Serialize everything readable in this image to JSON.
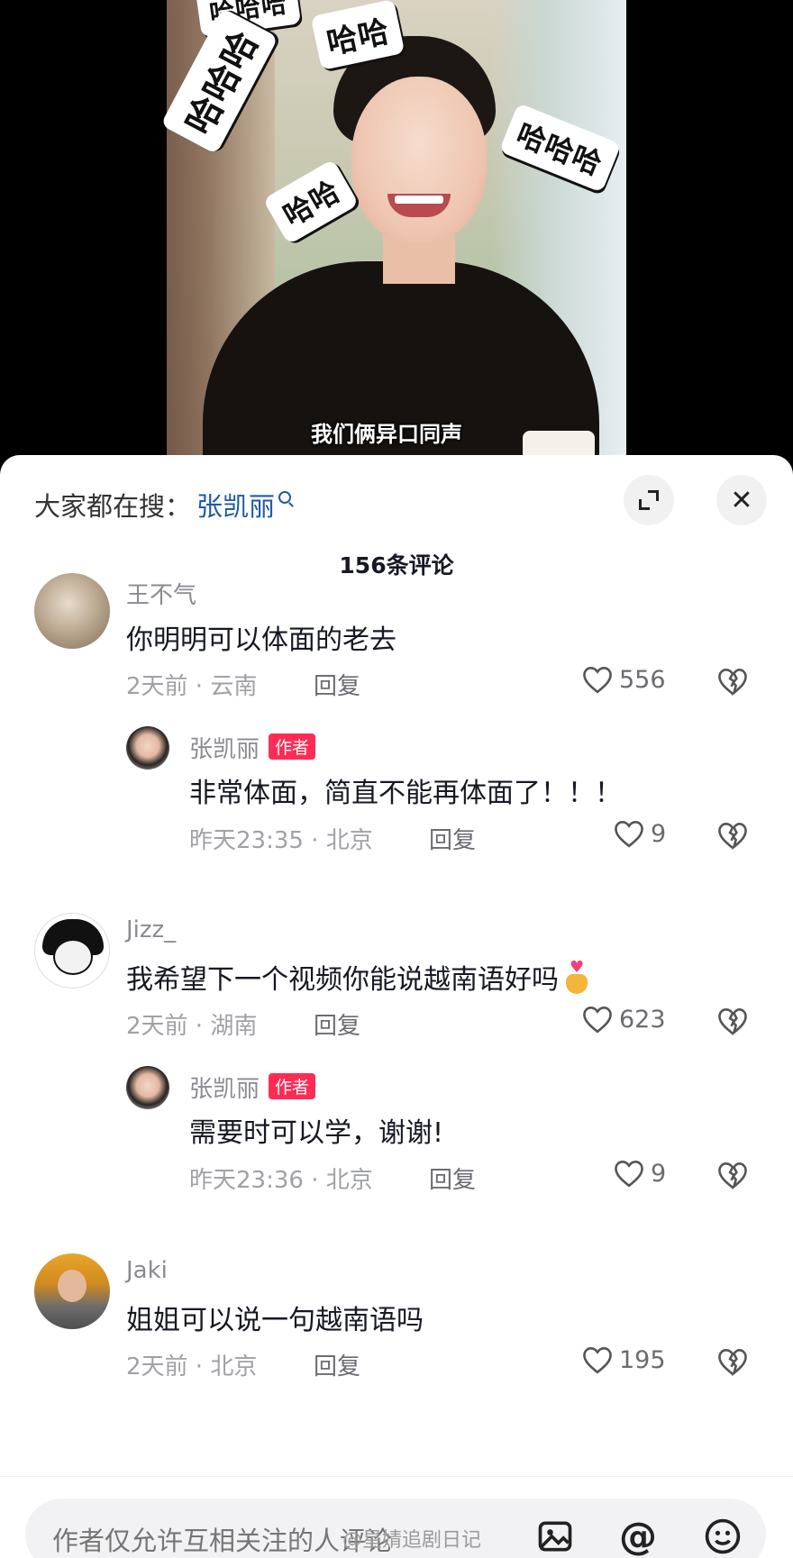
{
  "video": {
    "stickers": [
      "哈哈哈",
      "哈哈",
      "哈哈哈",
      "哈哈哈",
      "哈哈"
    ],
    "subtitle": "我们俩异口同声"
  },
  "panel": {
    "search_prefix": "大家都在搜：",
    "search_term": "张凯丽",
    "comment_count": "156条评论",
    "close_symbol": "✕"
  },
  "comments": [
    {
      "user": "王不气",
      "text": "你明明可以体面的老去",
      "time_location": "2天前 · 云南",
      "reply_label": "回复",
      "likes": "556",
      "reply": {
        "user": "张凯丽",
        "tag": "作者",
        "text": "非常体面，简直不能再体面了！！！",
        "time_location": "昨天23:35 · 北京",
        "reply_label": "回复",
        "likes": "9"
      }
    },
    {
      "user": "Jizz_",
      "text": "我希望下一个视频你能说越南语好吗",
      "time_location": "2天前 · 湖南",
      "reply_label": "回复",
      "likes": "623",
      "reply": {
        "user": "张凯丽",
        "tag": "作者",
        "text": "需要时可以学，谢谢!",
        "time_location": "昨天23:36 · 北京",
        "reply_label": "回复",
        "likes": "9"
      }
    },
    {
      "user": "Jaki",
      "text": "姐姐可以说一句越南语吗",
      "time_location": "2天前 · 北京",
      "reply_label": "回复",
      "likes": "195"
    }
  ],
  "input_bar": {
    "placeholder": "作者仅允许互相关注的人评论",
    "at_symbol": "@"
  },
  "watermark": "@星婧追剧日记",
  "colors": {
    "author_tag": "#fe2c55",
    "search_term": "#1f5aa6",
    "panel_bg": "#ffffff"
  }
}
